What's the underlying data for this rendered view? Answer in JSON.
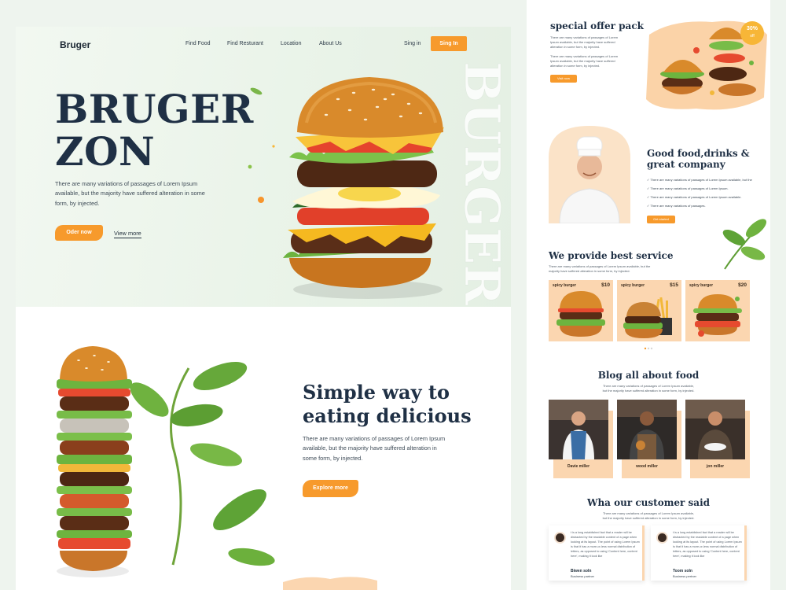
{
  "header": {
    "brand": "Bruger",
    "nav": [
      "Find Food",
      "Find Resturant",
      "Location",
      "About Us"
    ],
    "signin_link": "Sing in",
    "signin_button": "Sing In"
  },
  "hero": {
    "title_line1": "BRUGER",
    "title_line2": "ZON",
    "description": "There are many variations of passages of Lorem Ipsum available, but the majority have suffered alteration in some form, by injected.",
    "order_button": "Oder now",
    "view_more": "View more",
    "watermark": "BURGER"
  },
  "section2": {
    "title_line1": "Simple way to",
    "title_line2": "eating delicious",
    "description": "There are many variations of passages of Lorem Ipsum available, but the majority have suffered alteration in some form, by injected.",
    "button": "Explore more"
  },
  "offer": {
    "title": "special offer pack",
    "text1": "There are many variations of passages of Lorem Ipsum available, but the majority have suffered alteration in some form, by injected.",
    "text2": "There are many variations of passages of Lorem Ipsum available, but the majority have suffered alteration in some form, by injected.",
    "button": "Visit now",
    "badge_percent": "30%",
    "badge_label": "off"
  },
  "about": {
    "title_line1": "Good food,drinks &",
    "title_line2": "great company",
    "checks": [
      "There are many variations of passages of Lorem Ipsum available, but the",
      "There are many variations of passages of Lorem Ipsum.",
      "There are many variations of passages of Lorem Ipsum available.",
      "There are many variations of passages."
    ],
    "button": "Get started"
  },
  "service": {
    "title": "We provide best service",
    "text": "There are many variations of passages of Lorem Ipsum available, but the majority have suffered alteration in some form, by injected.",
    "cards": [
      {
        "name": "spicy burger",
        "price": "$10"
      },
      {
        "name": "spicy burger",
        "price": "$15"
      },
      {
        "name": "spicy burger",
        "price": "$20"
      }
    ]
  },
  "blog": {
    "title": "Blog all about food",
    "text": "There are many variations of passages of Lorem Ipsum available, but the majority have suffered alteration in some form, by injected.",
    "authors": [
      "Davie miller",
      "wood miller",
      "jon miller"
    ]
  },
  "testimonials": {
    "title": "Wha our customer said",
    "text": "There are many variations of passages of Lorem Ipsum available, but the majority have suffered alteration in some form, by injected.",
    "items": [
      {
        "quote": "t is a long established fact that a reader will be distracted by the readable content of a page when looking at its layout. The point of using Lorem Ipsum is that it has a more-or-less normal distribution of letters, as opposed to using 'Content here, content here', making it look like",
        "name": "Biwen soln",
        "role": "Business partner"
      },
      {
        "quote": "t is a long established fact that a reader will be distracted by the readable content of a page when looking at its layout. The point of using Lorem Ipsum is that it has a more-or-less normal distribution of letters, as opposed to using 'Content here, content here', making it look like",
        "name": "Toom soln",
        "role": "Business pertner"
      }
    ]
  },
  "colors": {
    "accent": "#f79a2c",
    "heading": "#1f3045",
    "peach": "#fbd6b0",
    "mint": "#eef4ee"
  }
}
